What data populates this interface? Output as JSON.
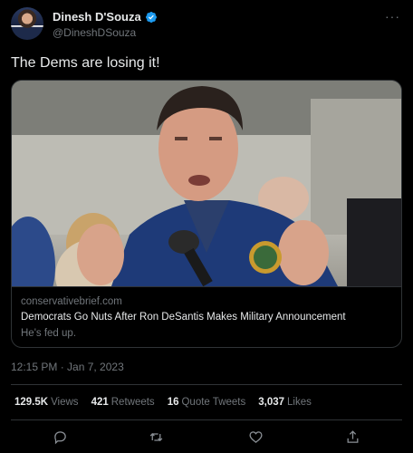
{
  "author": {
    "name": "Dinesh D'Souza",
    "handle": "@DineshDSouza",
    "verified": true
  },
  "tweet": {
    "text": "The Dems are losing it!",
    "timestamp": "12:15 PM · Jan 7, 2023"
  },
  "card": {
    "domain": "conservativebrief.com",
    "title": "Democrats Go Nuts After Ron DeSantis Makes Military Announcement",
    "description": "He's fed up."
  },
  "stats": {
    "views_count": "129.5K",
    "views_label": "Views",
    "retweets_count": "421",
    "retweets_label": "Retweets",
    "quotes_count": "16",
    "quotes_label": "Quote Tweets",
    "likes_count": "3,037",
    "likes_label": "Likes"
  },
  "icons": {
    "more": "more-icon",
    "reply": "reply-icon",
    "retweet": "retweet-icon",
    "like": "heart-icon",
    "share": "share-icon",
    "verified": "verified-badge-icon"
  },
  "colors": {
    "background": "#000000",
    "text_primary": "#e7e9ea",
    "text_secondary": "#71767b",
    "border": "#2f3336",
    "verified_blue": "#1d9bf0"
  }
}
